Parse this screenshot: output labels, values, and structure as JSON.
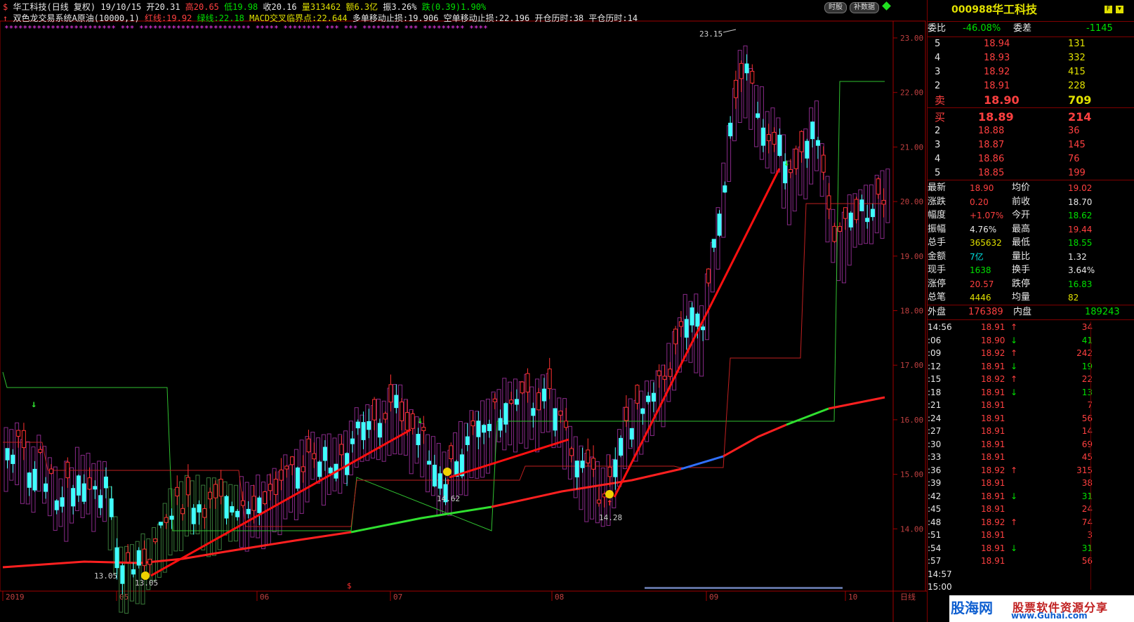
{
  "header": {
    "stock_title": "华工科技(日线 复权)",
    "date": "19/10/15",
    "open": "开20.31",
    "high": "高20.65",
    "low": "低19.98",
    "close": "收20.16",
    "volume": "量313462",
    "amount": "额6.3亿",
    "amplitude": "振3.26%",
    "change": "跌(0.39)1.90%"
  },
  "indicator_line": {
    "name": "双色龙交易系统A原油(10000,1)",
    "red_line": "红线:19.92",
    "green_line": "绿线:22.18",
    "macd": "MACD交叉临界点:22.644",
    "long_stop": "多单移动止损:19.906",
    "short_stop": "空单移动止损:22.196",
    "open_days": "开仓历时:38",
    "close_days": "平仓历时:14"
  },
  "buttons": {
    "timeshare": "时股",
    "supplement": "补数据"
  },
  "y_axis": [
    "23.00",
    "22.00",
    "21.00",
    "20.00",
    "19.00",
    "18.00",
    "17.00",
    "16.00",
    "15.00",
    "14.00"
  ],
  "x_axis": {
    "labels": [
      "2019",
      "05",
      "06",
      "07",
      "08",
      "09",
      "10"
    ],
    "period": "日线"
  },
  "annotations": {
    "high_label": "23.15",
    "low_label_1": "13.05",
    "low_label_2": "13.05",
    "low_label_3": "14.62",
    "low_label_4": "14.28",
    "dollar": "$"
  },
  "colors": {
    "up": "#ff3030",
    "down": "#40ffff",
    "ma_red": "#ff2020",
    "ma_green": "#30e030",
    "cloud": "#a040a0"
  },
  "quote": {
    "code": "000988",
    "name": "华工科技",
    "weibi_label": "委比",
    "weibi": "-46.08%",
    "weicha_label": "委差",
    "weicha": "-1145",
    "sell": [
      {
        "lvl": "5",
        "price": "18.94",
        "vol": "131"
      },
      {
        "lvl": "4",
        "price": "18.93",
        "vol": "332"
      },
      {
        "lvl": "3",
        "price": "18.92",
        "vol": "415"
      },
      {
        "lvl": "2",
        "price": "18.91",
        "vol": "228"
      },
      {
        "lvl": "卖",
        "price": "18.90",
        "vol": "709"
      }
    ],
    "buy": [
      {
        "lvl": "买",
        "price": "18.89",
        "vol": "214"
      },
      {
        "lvl": "2",
        "price": "18.88",
        "vol": "36"
      },
      {
        "lvl": "3",
        "price": "18.87",
        "vol": "145"
      },
      {
        "lvl": "4",
        "price": "18.86",
        "vol": "76"
      },
      {
        "lvl": "5",
        "price": "18.85",
        "vol": "199"
      }
    ],
    "stats": [
      {
        "l1": "最新",
        "v1": "18.90",
        "l2": "均价",
        "v2": "19.02"
      },
      {
        "l1": "涨跌",
        "v1": "0.20",
        "l2": "前收",
        "v2": "18.70"
      },
      {
        "l1": "幅度",
        "v1": "+1.07%",
        "l2": "今开",
        "v2": "18.62"
      },
      {
        "l1": "振幅",
        "v1": "4.76%",
        "l2": "最高",
        "v2": "19.44"
      },
      {
        "l1": "总手",
        "v1": "365632",
        "l2": "最低",
        "v2": "18.55"
      },
      {
        "l1": "金额",
        "v1": "7亿",
        "l2": "量比",
        "v2": "1.32"
      },
      {
        "l1": "现手",
        "v1": "1638",
        "l2": "换手",
        "v2": "3.64%"
      },
      {
        "l1": "涨停",
        "v1": "20.57",
        "l2": "跌停",
        "v2": "16.83"
      },
      {
        "l1": "总笔",
        "v1": "4446",
        "l2": "均量",
        "v2": "82"
      }
    ],
    "outer_label": "外盘",
    "outer": "176389",
    "inner_label": "内盘",
    "inner": "189243",
    "ticks": [
      {
        "t": "14:56",
        "p": "18.91",
        "d": "↑",
        "v": "34"
      },
      {
        "t": ":06",
        "p": "18.90",
        "d": "↓",
        "v": "41"
      },
      {
        "t": ":09",
        "p": "18.92",
        "d": "↑",
        "v": "242"
      },
      {
        "t": ":12",
        "p": "18.91",
        "d": "↓",
        "v": "19"
      },
      {
        "t": ":15",
        "p": "18.92",
        "d": "↑",
        "v": "22"
      },
      {
        "t": ":18",
        "p": "18.91",
        "d": "↓",
        "v": "13"
      },
      {
        "t": ":21",
        "p": "18.91",
        "d": "",
        "v": "7"
      },
      {
        "t": ":24",
        "p": "18.91",
        "d": "",
        "v": "56"
      },
      {
        "t": ":27",
        "p": "18.91",
        "d": "",
        "v": "14"
      },
      {
        "t": ":30",
        "p": "18.91",
        "d": "",
        "v": "69"
      },
      {
        "t": ":33",
        "p": "18.91",
        "d": "",
        "v": "45"
      },
      {
        "t": ":36",
        "p": "18.92",
        "d": "↑",
        "v": "315"
      },
      {
        "t": ":39",
        "p": "18.91",
        "d": "",
        "v": "38"
      },
      {
        "t": ":42",
        "p": "18.91",
        "d": "↓",
        "v": "31"
      },
      {
        "t": ":45",
        "p": "18.91",
        "d": "",
        "v": "24"
      },
      {
        "t": ":48",
        "p": "18.92",
        "d": "↑",
        "v": "74"
      },
      {
        "t": ":51",
        "p": "18.91",
        "d": "",
        "v": "3"
      },
      {
        "t": ":54",
        "p": "18.91",
        "d": "↓",
        "v": "31"
      },
      {
        "t": ":57",
        "p": "18.91",
        "d": "",
        "v": "56"
      },
      {
        "t": "14:57",
        "p": "",
        "d": "",
        "v": ""
      },
      {
        "t": "15:00",
        "p": "",
        "d": "",
        "v": ""
      }
    ]
  },
  "watermark": {
    "brand": "股海网",
    "slogan": "股票软件资源分享",
    "url": "www.Guhai.com"
  }
}
